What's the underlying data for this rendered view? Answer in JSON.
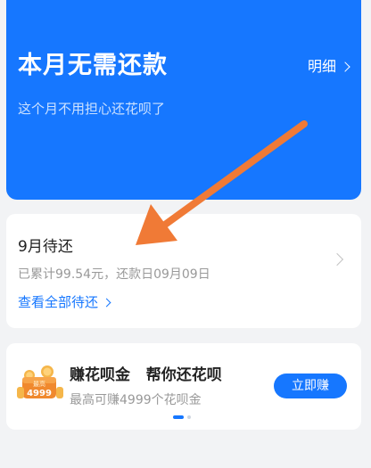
{
  "hero": {
    "title": "本月无需还款",
    "subtitle": "这个月不用担心还花呗了",
    "detail_link": "明细",
    "bg_color": "#1677ff"
  },
  "due_card": {
    "title": "9月待还",
    "info": "已累计99.54元，还款日09月09日",
    "link": "查看全部待还",
    "arrow_icon": "chevron-right-icon"
  },
  "promo_card": {
    "title": "赚花呗金   帮你还花呗",
    "subtitle": "最高可赚4999个花呗金",
    "button": "立即赚",
    "badge_label": "最高",
    "badge_value": "4999",
    "carousel": {
      "total": 2,
      "active": 0
    }
  },
  "annotation": {
    "arrow_color": "#f07a36",
    "icon": "annotation-arrow-icon"
  }
}
